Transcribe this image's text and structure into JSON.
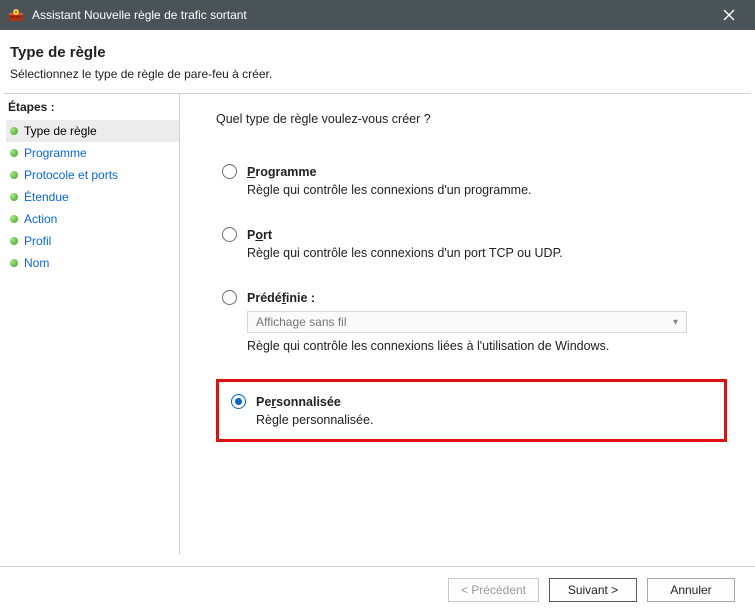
{
  "titlebar": {
    "title": "Assistant Nouvelle règle de trafic sortant"
  },
  "header": {
    "title": "Type de règle",
    "subtitle": "Sélectionnez le type de règle de pare-feu à créer."
  },
  "steps": {
    "title": "Étapes :",
    "items": [
      {
        "label": "Type de règle",
        "current": true
      },
      {
        "label": "Programme",
        "current": false
      },
      {
        "label": "Protocole et ports",
        "current": false
      },
      {
        "label": "Étendue",
        "current": false
      },
      {
        "label": "Action",
        "current": false
      },
      {
        "label": "Profil",
        "current": false
      },
      {
        "label": "Nom",
        "current": false
      }
    ]
  },
  "content": {
    "prompt": "Quel type de règle voulez-vous créer ?",
    "options": {
      "programme": {
        "label": "Programme",
        "desc": "Règle qui contrôle les connexions d'un programme.",
        "selected": false
      },
      "port": {
        "label": "Port",
        "desc": "Règle qui contrôle les connexions d'un port TCP ou UDP.",
        "selected": false
      },
      "predefinie": {
        "label": "Prédéfinie :",
        "select_value": "Affichage sans fil",
        "desc": "Règle qui contrôle les connexions liées à l'utilisation de Windows.",
        "selected": false
      },
      "personnalisee": {
        "label": "Personnalisée",
        "desc": "Règle personnalisée.",
        "selected": true
      }
    }
  },
  "footer": {
    "back": "< Précédent",
    "next": "Suivant >",
    "cancel": "Annuler"
  }
}
